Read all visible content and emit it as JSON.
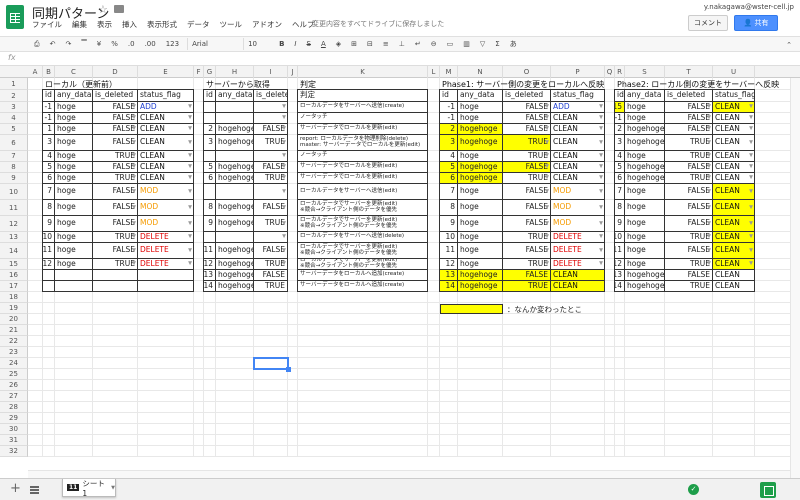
{
  "app": {
    "title": "同期パターン",
    "user_email": "y.nakagawa@wster-cell.jp",
    "comment_label": "コメント",
    "share_label": "共有",
    "save_status": "変更内容をすべてドライブに保存しました",
    "menu": [
      "ファイル",
      "編集",
      "表示",
      "挿入",
      "表示形式",
      "データ",
      "ツール",
      "アドオン",
      "ヘルプ"
    ]
  },
  "toolbar": {
    "percent": "%",
    "dec_minus": ".0",
    "dec_plus": ".00",
    "format_123": "123",
    "font": "Arial",
    "size": "10",
    "bold": "B",
    "italic": "I",
    "strike": "S",
    "text_color": "A",
    "currency": "¥"
  },
  "formula_bar": {
    "fx": "fx"
  },
  "columns": [
    "A",
    "B",
    "C",
    "D",
    "E",
    "F",
    "G",
    "H",
    "I",
    "J",
    "K",
    "L",
    "M",
    "N",
    "O",
    "P",
    "Q",
    "R",
    "S",
    "T",
    "U"
  ],
  "rows": [
    "1",
    "2",
    "3",
    "4",
    "5",
    "6",
    "7",
    "8",
    "9",
    "10",
    "11",
    "12",
    "13",
    "14",
    "15",
    "16",
    "17",
    "18",
    "19",
    "20",
    "21",
    "22",
    "23",
    "24",
    "25",
    "26",
    "27",
    "28",
    "29",
    "30",
    "31",
    "32"
  ],
  "sections": {
    "local": "ローカル（更新前）",
    "server": "サーバーから取得",
    "judge": "判定",
    "phase1": "Phase1: サーバー側の変更をローカルへ反映",
    "phase2": "Phase2: ローカル側の変更をサーバーへ反映"
  },
  "headers": {
    "local": [
      "id",
      "any_data",
      "is_deleted",
      "status_flag"
    ],
    "server": [
      "id",
      "any_data",
      "is_deleted"
    ],
    "judge": [
      "判定"
    ],
    "phase1": [
      "id",
      "any_data",
      "is_deleted",
      "status_flag"
    ],
    "phase2": [
      "id",
      "any_data",
      "is_deleted",
      "status_flag"
    ]
  },
  "local": [
    [
      "-1",
      "hoge",
      "FALSE",
      "ADD"
    ],
    [
      "-1",
      "hoge",
      "FALSE",
      "CLEAN"
    ],
    [
      "1",
      "hoge",
      "FALSE",
      "CLEAN"
    ],
    [
      "3",
      "hoge",
      "FALSE",
      "CLEAN"
    ],
    [
      "4",
      "hoge",
      "TRUE",
      "CLEAN"
    ],
    [
      "5",
      "hoge",
      "FALSE",
      "CLEAN"
    ],
    [
      "6",
      "hoge",
      "TRUE",
      "CLEAN"
    ],
    [
      "7",
      "hoge",
      "FALSE",
      "MOD"
    ],
    [
      "8",
      "hoge",
      "FALSE",
      "MOD"
    ],
    [
      "9",
      "hoge",
      "FALSE",
      "MOD"
    ],
    [
      "10",
      "hoge",
      "TRUE",
      "DELETE"
    ],
    [
      "11",
      "hoge",
      "FALSE",
      "DELETE"
    ],
    [
      "12",
      "hoge",
      "TRUE",
      "DELETE"
    ],
    [
      "",
      "",
      "",
      ""
    ],
    [
      "",
      "",
      "",
      ""
    ]
  ],
  "server": [
    [
      "",
      "",
      ""
    ],
    [
      "",
      "",
      ""
    ],
    [
      "2",
      "hogehoge",
      "FALSE"
    ],
    [
      "3",
      "hogehoge",
      "TRUE"
    ],
    [
      "",
      "",
      ""
    ],
    [
      "5",
      "hogehoge",
      "FALSE"
    ],
    [
      "6",
      "hogehoge",
      "TRUE"
    ],
    [
      "",
      "",
      ""
    ],
    [
      "8",
      "hogehoge",
      "FALSE"
    ],
    [
      "9",
      "hogehoge",
      "TRUE"
    ],
    [
      "",
      "",
      ""
    ],
    [
      "11",
      "hogehoge",
      "FALSE"
    ],
    [
      "12",
      "hogehoge",
      "TRUE"
    ],
    [
      "13",
      "hogehoge",
      "FALSE"
    ],
    [
      "14",
      "hogehoge",
      "TRUE"
    ]
  ],
  "judge": [
    "ローカルデータをサーバーへ送信(create)",
    "ノータッチ",
    "サーバーデータでローカルを更新(edit)",
    "report: ローカルデータを物理削除(delete)\nmaster: サーバーデータでローカルを更新(edit)",
    "ノータッチ",
    "サーバーデータでローカルを更新(edit)",
    "サーバーデータでローカルを更新(edit)",
    "ローカルデータをサーバーへ送信(edit)",
    "ローカルデータでサーバーを更新(edit)\n※競合→クライアント側のデータを優先",
    "ローカルデータでサーバーを更新(edit)\n※競合→クライアント側のデータを優先",
    "ローカルデータをサーバーへ送信(delete)",
    "ローカルデータでサーバーを更新(edit)\n※競合→クライアント側のデータを優先",
    "ローカルデータでサーバーを更新(edit)\n※競合→クライアント側のデータを優先",
    "サーバーデータをローカルへ追加(create)",
    "サーバーデータをローカルへ追加(create)"
  ],
  "phase1": [
    [
      "-1",
      "hoge",
      "FALSE",
      "ADD"
    ],
    [
      "-1",
      "hoge",
      "FALSE",
      "CLEAN"
    ],
    [
      "2",
      "hogehoge",
      "FALSE",
      "CLEAN"
    ],
    [
      "3",
      "hogehoge",
      "TRUE",
      "CLEAN"
    ],
    [
      "4",
      "hoge",
      "TRUE",
      "CLEAN"
    ],
    [
      "5",
      "hogehoge",
      "FALSE",
      "CLEAN"
    ],
    [
      "6",
      "hogehoge",
      "TRUE",
      "CLEAN"
    ],
    [
      "7",
      "hoge",
      "FALSE",
      "MOD"
    ],
    [
      "8",
      "hoge",
      "FALSE",
      "MOD"
    ],
    [
      "9",
      "hoge",
      "FALSE",
      "MOD"
    ],
    [
      "10",
      "hoge",
      "TRUE",
      "DELETE"
    ],
    [
      "11",
      "hoge",
      "FALSE",
      "DELETE"
    ],
    [
      "12",
      "hoge",
      "TRUE",
      "DELETE"
    ],
    [
      "13",
      "hogehoge",
      "FALSE",
      "CLEAN"
    ],
    [
      "14",
      "hogehoge",
      "TRUE",
      "CLEAN"
    ]
  ],
  "phase1_highlight": [
    [
      0,
      0,
      0,
      0
    ],
    [
      0,
      0,
      0,
      0
    ],
    [
      1,
      1,
      0,
      0
    ],
    [
      1,
      1,
      1,
      0
    ],
    [
      0,
      0,
      0,
      0
    ],
    [
      1,
      1,
      1,
      0
    ],
    [
      1,
      1,
      0,
      0
    ],
    [
      0,
      0,
      0,
      0
    ],
    [
      0,
      0,
      0,
      0
    ],
    [
      0,
      0,
      0,
      0
    ],
    [
      0,
      0,
      0,
      0
    ],
    [
      0,
      0,
      0,
      0
    ],
    [
      0,
      0,
      0,
      0
    ],
    [
      1,
      1,
      1,
      1
    ],
    [
      1,
      1,
      1,
      1
    ]
  ],
  "phase2": [
    [
      "15",
      "hoge",
      "FALSE",
      "CLEAN"
    ],
    [
      "-1",
      "hoge",
      "FALSE",
      "CLEAN"
    ],
    [
      "2",
      "hogehoge",
      "FALSE",
      "CLEAN"
    ],
    [
      "3",
      "hogehoge",
      "TRUE",
      "CLEAN"
    ],
    [
      "4",
      "hoge",
      "TRUE",
      "CLEAN"
    ],
    [
      "5",
      "hogehoge",
      "FALSE",
      "CLEAN"
    ],
    [
      "6",
      "hogehoge",
      "TRUE",
      "CLEAN"
    ],
    [
      "7",
      "hoge",
      "FALSE",
      "CLEAN"
    ],
    [
      "8",
      "hoge",
      "FALSE",
      "CLEAN"
    ],
    [
      "9",
      "hoge",
      "FALSE",
      "CLEAN"
    ],
    [
      "10",
      "hoge",
      "TRUE",
      "CLEAN"
    ],
    [
      "11",
      "hoge",
      "FALSE",
      "CLEAN"
    ],
    [
      "12",
      "hoge",
      "TRUE",
      "CLEAN"
    ],
    [
      "13",
      "hogehoge",
      "FALSE",
      "CLEAN"
    ],
    [
      "14",
      "hogehoge",
      "TRUE",
      "CLEAN"
    ]
  ],
  "phase2_highlight": [
    [
      1,
      0,
      0,
      1
    ],
    [
      0,
      0,
      0,
      0
    ],
    [
      0,
      0,
      0,
      0
    ],
    [
      0,
      0,
      0,
      0
    ],
    [
      0,
      0,
      0,
      0
    ],
    [
      0,
      0,
      0,
      0
    ],
    [
      0,
      0,
      0,
      0
    ],
    [
      0,
      0,
      0,
      1
    ],
    [
      0,
      0,
      0,
      1
    ],
    [
      0,
      0,
      0,
      1
    ],
    [
      0,
      0,
      0,
      1
    ],
    [
      0,
      0,
      0,
      1
    ],
    [
      0,
      0,
      0,
      1
    ],
    [
      0,
      0,
      0,
      0
    ],
    [
      0,
      0,
      0,
      0
    ]
  ],
  "legend": {
    "text": "：なんか変わったとこ"
  },
  "sheet": {
    "badge": "11",
    "name": "シート1"
  },
  "colors": {
    "add": "#1f3fd1",
    "mod": "#f59b00",
    "delete": "#e00000",
    "highlight": "#ffff00",
    "share": "#4d90fe"
  }
}
